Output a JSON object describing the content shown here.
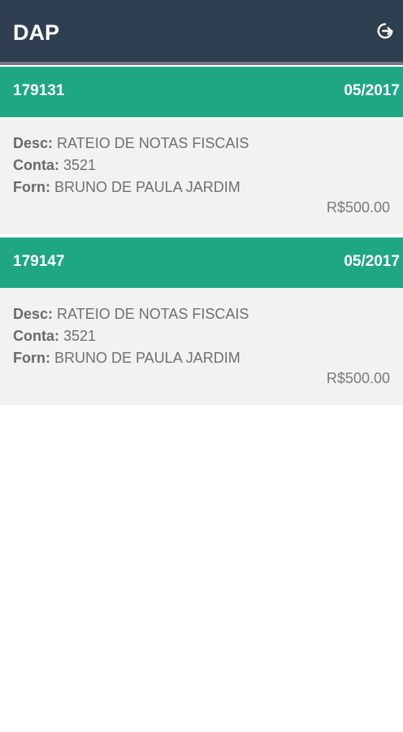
{
  "header": {
    "title": "DAP",
    "logout_icon": "logout-icon"
  },
  "labels": {
    "desc": "Desc:",
    "conta": "Conta:",
    "forn": "Forn:"
  },
  "items": [
    {
      "id": "179131",
      "date": "05/2017",
      "desc": "RATEIO DE NOTAS FISCAIS",
      "conta": "3521",
      "forn": "BRUNO DE PAULA JARDIM",
      "value": "R$500.00"
    },
    {
      "id": "179147",
      "date": "05/2017",
      "desc": "RATEIO DE NOTAS FISCAIS",
      "conta": "3521",
      "forn": "BRUNO DE PAULA JARDIM",
      "value": "R$500.00"
    }
  ],
  "colors": {
    "app_bar": "#2f3e50",
    "item_header": "#1fa784",
    "item_body": "#f2f2f2"
  }
}
